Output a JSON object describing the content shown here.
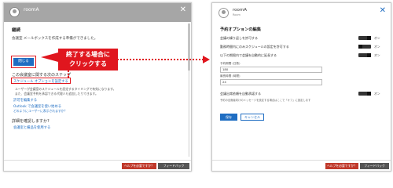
{
  "left_dialog": {
    "room_name": "roomA",
    "close_glyph": "✕",
    "done_title": "継続",
    "done_message": "会議室 メールボックスを作成する準備ができました。",
    "close_button_label": "閉じる",
    "next_steps_title": "この会議室に関する次のステップ",
    "schedule_link": "スケジュール オプションを設定する",
    "schedule_desc_line1": "ユーザーが会議室のスケジュールを設定するタイミングで有効になります。",
    "schedule_desc_line2": "また、会議室予約を承認できる代理人も追加したりできます。",
    "permissions_link": "許可を編集する",
    "outlook_link": "Outlook で会議室を使い始める",
    "outlook_sub": "どのようにユーザーに表示されますか？",
    "detail_title": "詳細を確認しますか?",
    "detail_link": "会議室と備品を使用する",
    "footer_help": "ヘルプを必要ですか？",
    "footer_feedback": "フィードバック"
  },
  "callout": {
    "line1": "終了する場合に",
    "line2": "クリックする",
    "color": "#e0161e"
  },
  "right_dialog": {
    "room_name": "roomA",
    "room_sub": "Room",
    "close_glyph": "✕",
    "title": "予約オプションの編集",
    "options": [
      {
        "label": "会議の繰り返しを許可する",
        "state": "オン"
      },
      {
        "label": "勤務時間内にのみスケジュールの設定を許可する",
        "state": "オン"
      },
      {
        "label": "以下の期限内で会議を自動的に延長する",
        "state": "オン"
      }
    ],
    "field1_label": "予約期間 (日数)",
    "field1_value": "180",
    "field2_label": "最長時間 (時間)",
    "field2_value": "24",
    "option4": {
      "label": "会議出席依頼を自動承諾する",
      "state": "オン"
    },
    "note": "予約の出席者向けのメッセージを設定する場合はここで「オフ」に設定します",
    "save_label": "保存",
    "cancel_label": "キャンセル",
    "footer_help": "ヘルプを必要ですか？",
    "footer_feedback": "フィードバック"
  },
  "colors": {
    "accent": "#1f6dc2",
    "highlight": "#e0161e",
    "header_gray": "#a6a6a6"
  },
  "icons": [
    "avatar-icon",
    "close-icon",
    "arrow-icon"
  ]
}
